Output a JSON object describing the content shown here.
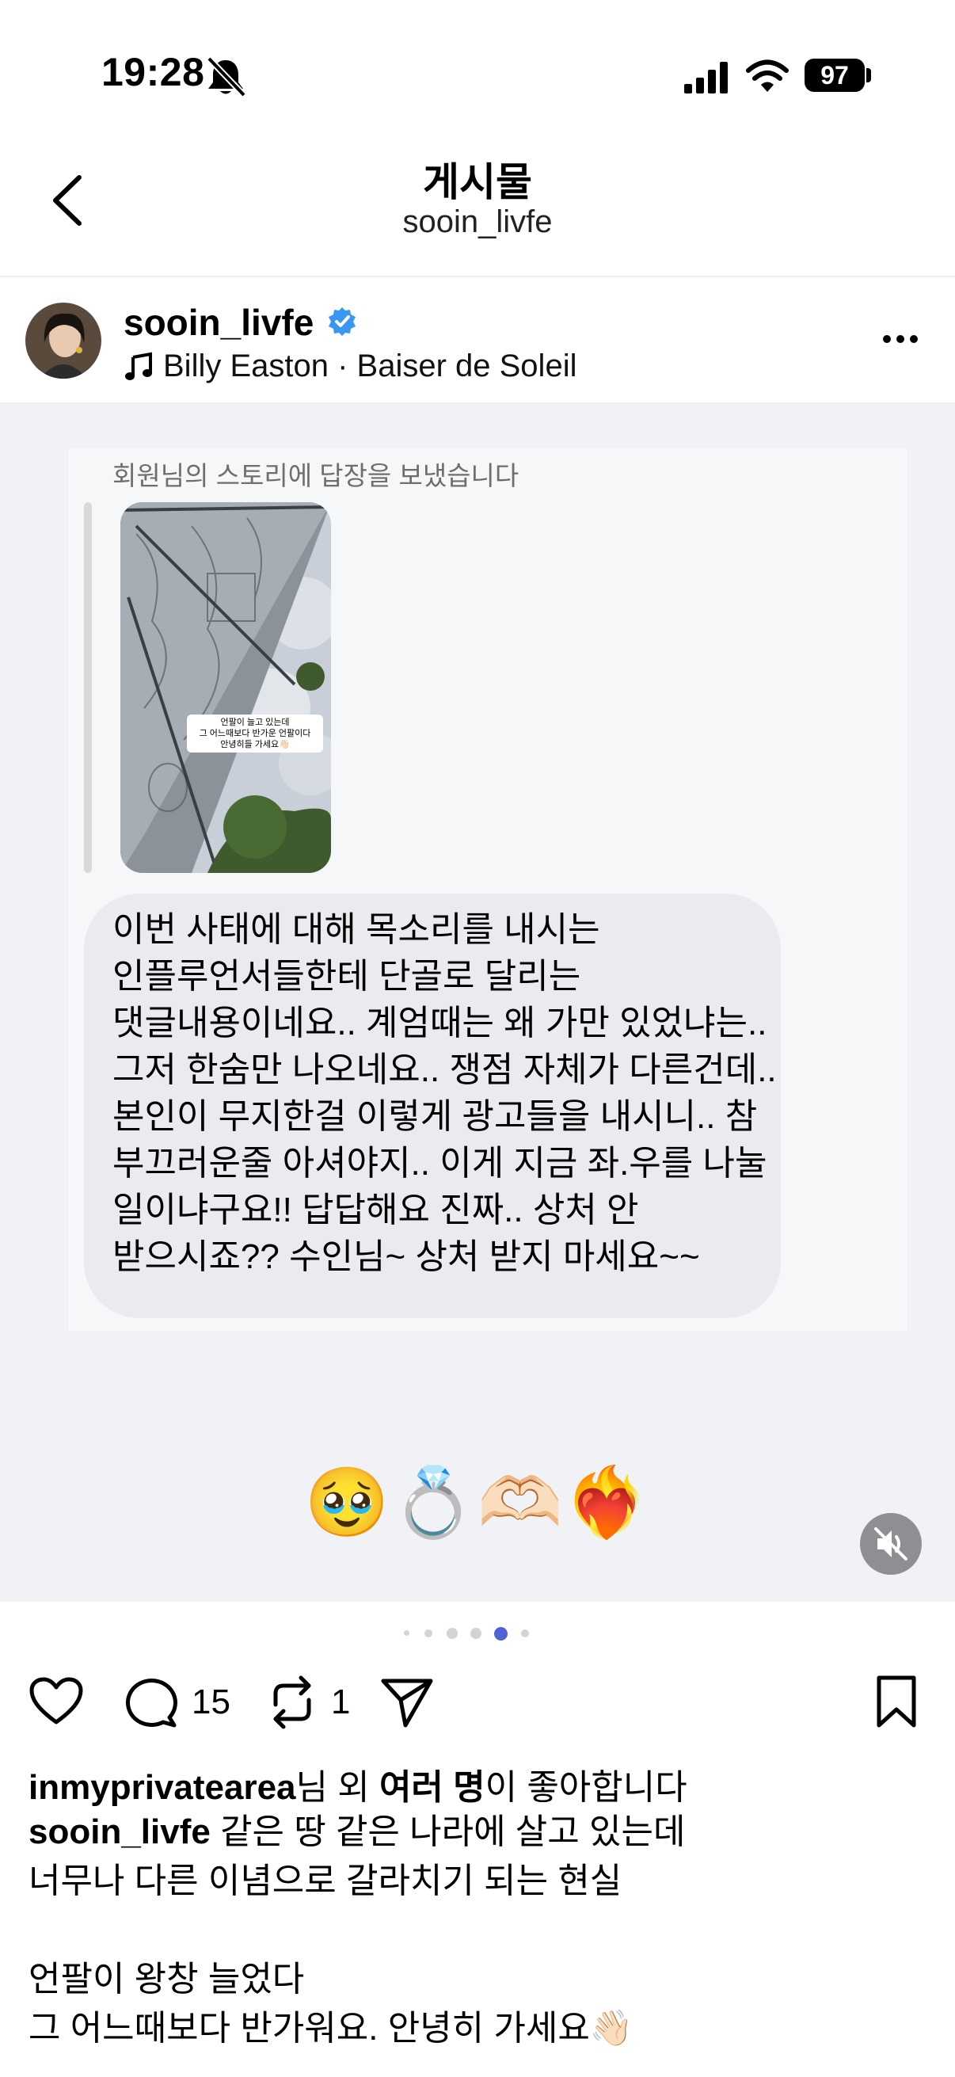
{
  "status_bar": {
    "time": "19:28",
    "battery": "97"
  },
  "header": {
    "title": "게시물",
    "subtitle": "sooin_livfe"
  },
  "author": {
    "username": "sooin_livfe",
    "music": "Billy Easton · Baiser de Soleil"
  },
  "media": {
    "reply_header": "회원님의 스토리에 답장을 보냈습니다",
    "story_overlay": "언팔이 늘고 있는데\n그 어느때보다 반가운 언팔이다\n안녕히들 가세요👋🏻",
    "message": "이번 사태에 대해 목소리를 내시는 인플루언서들한테 단골로 달리는 댓글내용이네요.. 계엄때는 왜 가만 있었냐는.. 그저 한숨만 나오네요.. 쟁점 자체가 다른건데.. 본인이 무지한걸 이렇게 광고들을 내시니.. 참 부끄러운줄 아셔야지.. 이게 지금 좌.우를 나눌 일이냐구요!! 답답해요 진짜.. 상처 안 받으시죠?? 수인님~ 상처 받지 마세요~~",
    "emojis": "🥹💍🫶🏻❤️‍🔥",
    "carousel_active_index": 4
  },
  "actions": {
    "comments": "15",
    "reposts": "1"
  },
  "likes": {
    "user": "inmyprivatearea",
    "mid": "님 외 ",
    "bold": "여러 명",
    "end": "이 좋아합니다"
  },
  "caption": {
    "username": "sooin_livfe",
    "text": " 같은 땅 같은 나라에 살고 있는데\n너무나 다른 이념으로 갈라치기 되는 현실\n\n언팔이 왕창 늘었다\n그 어느때보다 반가워요. 안녕히 가세요👋🏻"
  },
  "colors": {
    "verified": "#3897f0",
    "active_dot": "#4f63d2"
  },
  "icons": [
    "back-icon",
    "verified-icon",
    "music-note-icon",
    "more-icon",
    "mute-icon",
    "heart-icon",
    "comment-icon",
    "repost-icon",
    "share-icon",
    "bookmark-icon",
    "signal-icon",
    "wifi-icon",
    "bell-slash-icon"
  ]
}
